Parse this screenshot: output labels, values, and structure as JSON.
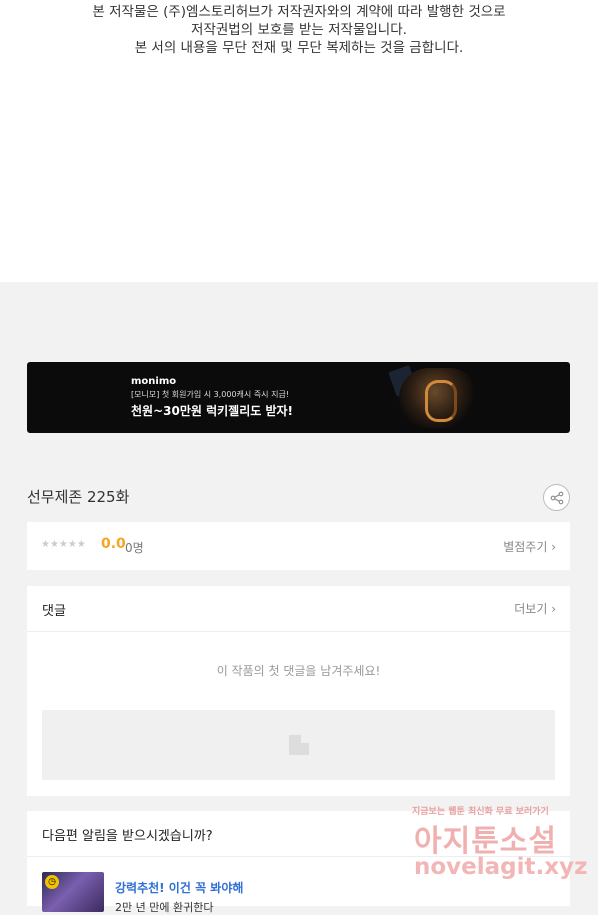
{
  "copyright": {
    "line1": "본 저작물은 (주)엠스토리허브가 저작권자와의 계약에 따라 발행한 것으로",
    "line2": "저작권법의 보호를 받는 저작물입니다.",
    "line3": "본 서의 내용을 무단 전재 및 무단 복제하는 것을 금합니다."
  },
  "banner": {
    "brand": "monimo",
    "sub": "[모니모] 첫 회원가입 시 3,000캐시 즉시 지급!",
    "main": "천원~30만원 럭키젤리도 받자!"
  },
  "episode": {
    "title": "선무제존 225화"
  },
  "rating": {
    "stars": "★★★★★",
    "score": "0.0",
    "count": "0명",
    "rate_label": "별점주기 ›"
  },
  "comments": {
    "title": "댓글",
    "more_label": "더보기 ›",
    "empty_text": "이 작품의 첫 댓글을 남겨주세요!"
  },
  "notify": {
    "title": "다음편 알림을 받으시겠습니까?",
    "recommend": "강력추천! 이건 꼭 봐야해",
    "desc": "2만 년 만에 환귀한다"
  },
  "watermark": {
    "small": "지금보는 웹툰 최신화 무료 보러가기",
    "big": "아지툰소설",
    "url": "novelagit.xyz"
  }
}
